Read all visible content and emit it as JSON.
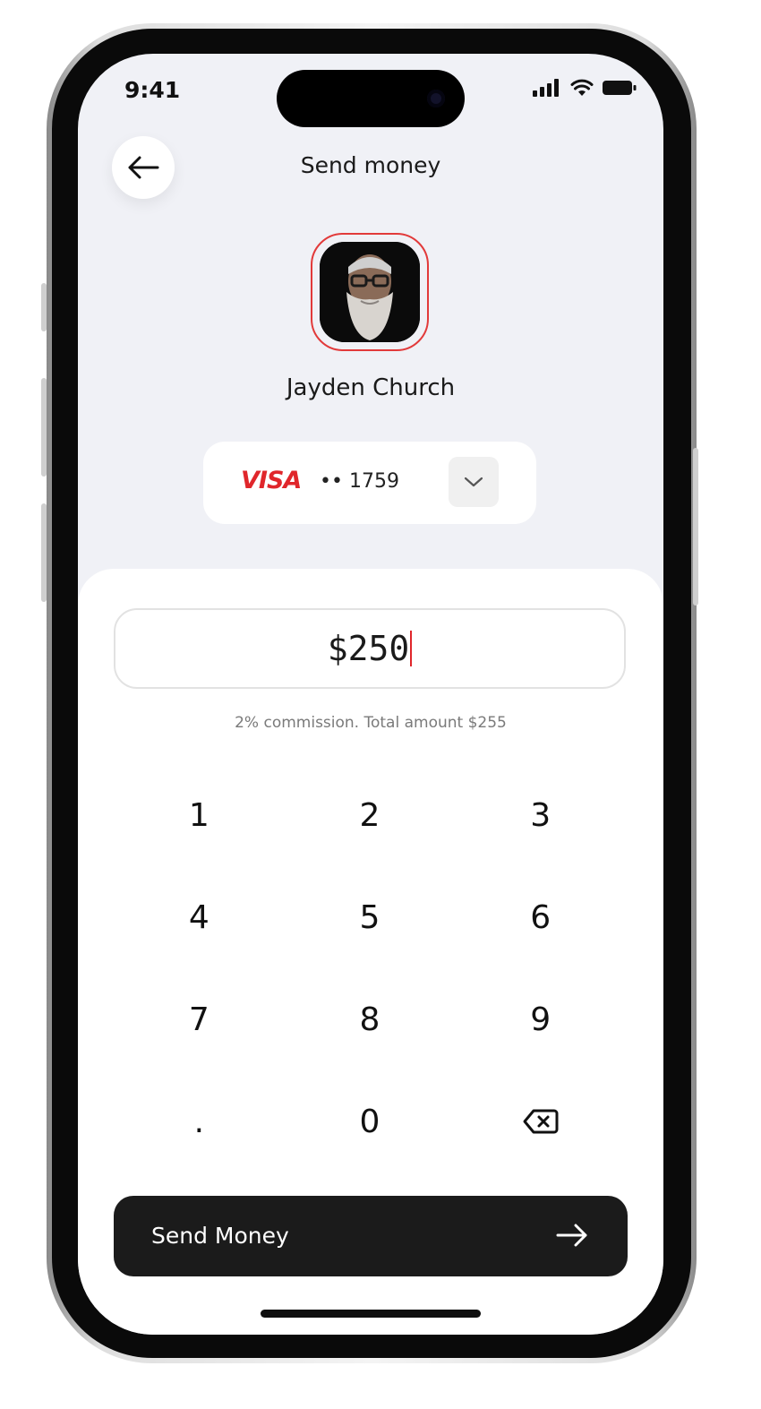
{
  "status_bar": {
    "time": "9:41"
  },
  "header": {
    "title": "Send money"
  },
  "recipient": {
    "name": "Jayden Church"
  },
  "card": {
    "brand": "VISA",
    "number": "•• 1759"
  },
  "amount": {
    "value": "$250",
    "commission_note": "2% commission. Total amount $255"
  },
  "keypad": {
    "keys": [
      "1",
      "2",
      "3",
      "4",
      "5",
      "6",
      "7",
      "8",
      "9",
      ".",
      "0"
    ],
    "delete_icon": "backspace-icon"
  },
  "actions": {
    "send_label": "Send Money"
  },
  "colors": {
    "accent": "#e0262b",
    "button": "#1b1b1b",
    "background": "#f0f1f6"
  }
}
